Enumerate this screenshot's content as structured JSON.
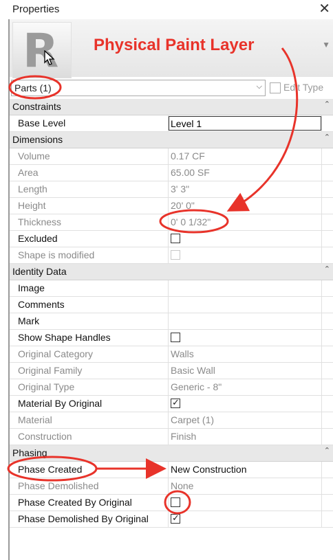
{
  "window": {
    "title": "Properties"
  },
  "type_selector": {
    "value": "Parts (1)",
    "edit_type_label": "Edit Type"
  },
  "annotation": {
    "text": "Physical Paint Layer",
    "color": "#e8332a"
  },
  "sections": [
    {
      "label": "Constraints",
      "rows": [
        {
          "key": "Base Level",
          "value": "Level 1",
          "kind": "edit"
        }
      ]
    },
    {
      "label": "Dimensions",
      "rows": [
        {
          "key": "Volume",
          "value": "0.17 CF",
          "dim": true
        },
        {
          "key": "Area",
          "value": "65.00 SF",
          "dim": true
        },
        {
          "key": "Length",
          "value": "3'  3\"",
          "dim": true
        },
        {
          "key": "Height",
          "value": "20'  0\"",
          "dim": true
        },
        {
          "key": "Thickness",
          "value": "0'  0 1/32\"",
          "dim": true
        },
        {
          "key": "Excluded",
          "value": "",
          "kind": "checkbox",
          "checked": false
        },
        {
          "key": "Shape is modified",
          "value": "",
          "kind": "checkbox",
          "checked": false,
          "dim": true
        }
      ]
    },
    {
      "label": "Identity Data",
      "rows": [
        {
          "key": "Image",
          "value": ""
        },
        {
          "key": "Comments",
          "value": ""
        },
        {
          "key": "Mark",
          "value": ""
        },
        {
          "key": "Show Shape Handles",
          "value": "",
          "kind": "checkbox",
          "checked": false
        },
        {
          "key": "Original Category",
          "value": "Walls",
          "dim": true
        },
        {
          "key": "Original Family",
          "value": "Basic Wall",
          "dim": true
        },
        {
          "key": "Original Type",
          "value": "Generic - 8\"",
          "dim": true
        },
        {
          "key": "Material By Original",
          "value": "",
          "kind": "checkbox",
          "checked": true
        },
        {
          "key": "Material",
          "value": "Carpet (1)",
          "dim": true
        },
        {
          "key": "Construction",
          "value": "Finish",
          "dim": true
        }
      ]
    },
    {
      "label": "Phasing",
      "rows": [
        {
          "key": "Phase Created",
          "value": "New Construction"
        },
        {
          "key": "Phase Demolished",
          "value": "None",
          "dim": true
        },
        {
          "key": "Phase Created By Original",
          "value": "",
          "kind": "checkbox",
          "checked": false
        },
        {
          "key": "Phase Demolished By Original",
          "value": "",
          "kind": "checkbox",
          "checked": true
        }
      ]
    }
  ]
}
